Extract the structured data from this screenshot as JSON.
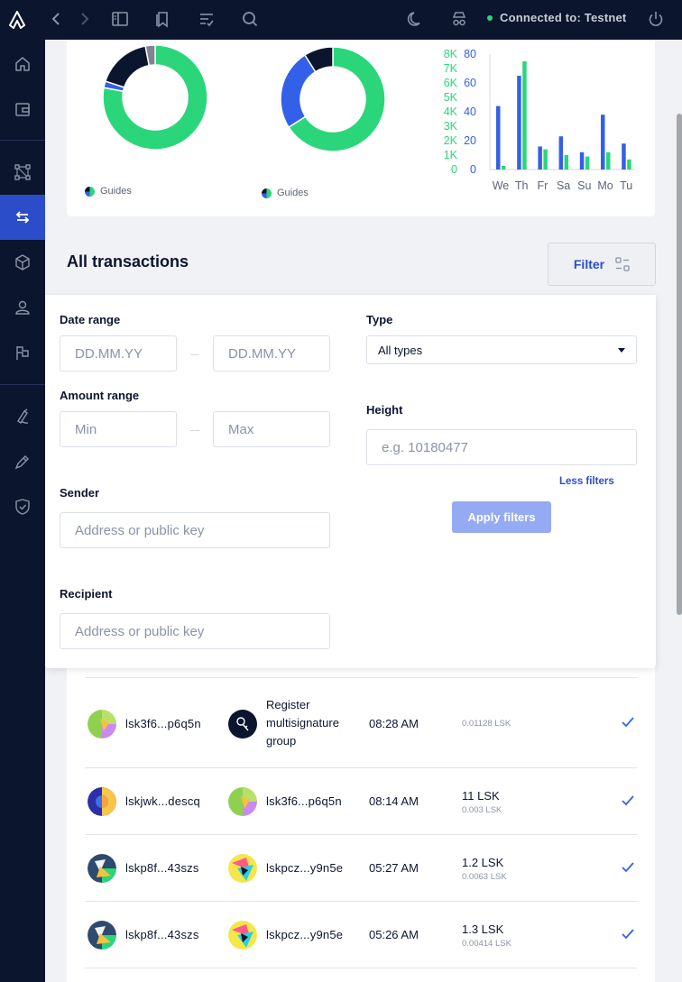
{
  "topbar": {
    "connection_label": "Connected to: Testnet"
  },
  "charts": {
    "left_legend": "Guides",
    "right_legend": "Guides"
  },
  "chart_data": [
    {
      "type": "pie",
      "variant": "donut",
      "slices": [
        {
          "value": 78,
          "color": "#2bd67b"
        },
        {
          "value": 2,
          "color": "#3360e8"
        },
        {
          "value": 17,
          "color": "#0c152e"
        },
        {
          "value": 3,
          "color": "#7e8494"
        }
      ],
      "legend": [
        "Guides"
      ]
    },
    {
      "type": "pie",
      "variant": "donut",
      "slices": [
        {
          "value": 66,
          "color": "#2bd67b"
        },
        {
          "value": 25,
          "color": "#3360e8"
        },
        {
          "value": 9,
          "color": "#0c152e"
        }
      ],
      "legend": [
        "Guides"
      ]
    },
    {
      "type": "bar",
      "categories": [
        "We",
        "Th",
        "Fr",
        "Sa",
        "Su",
        "Mo",
        "Tu"
      ],
      "series": [
        {
          "axis": "left_count",
          "color": "#3360e8",
          "values": [
            44,
            65,
            16,
            23,
            12,
            38,
            18
          ]
        },
        {
          "axis": "right_volume",
          "color": "#2bd67b",
          "values": [
            250,
            7500,
            1400,
            1000,
            900,
            1200,
            700
          ]
        }
      ],
      "y_left": {
        "ticks": [
          0,
          20,
          40,
          60,
          80
        ],
        "color": "#3360e8",
        "ylim": [
          0,
          80
        ]
      },
      "y_right": {
        "ticks": [
          "0",
          "1K",
          "2K",
          "3K",
          "4K",
          "5K",
          "6K",
          "7K",
          "8K"
        ],
        "color": "#2bd67b",
        "ylim": [
          0,
          8000
        ]
      }
    }
  ],
  "heading": {
    "title": "All transactions",
    "filter_label": "Filter"
  },
  "filters": {
    "date_range_label": "Date range",
    "date_from_placeholder": "DD.MM.YY",
    "date_to_placeholder": "DD.MM.YY",
    "type_label": "Type",
    "type_value": "All types",
    "amount_range_label": "Amount range",
    "amount_min_placeholder": "Min",
    "amount_max_placeholder": "Max",
    "height_label": "Height",
    "height_placeholder": "e.g. 10180477",
    "less_filters": "Less filters",
    "sender_label": "Sender",
    "sender_placeholder": "Address or public key",
    "apply_label": "Apply filters",
    "recipient_label": "Recipient",
    "recipient_placeholder": "Address or public key"
  },
  "transactions": [
    {
      "sender": "lsk3f6...p6q5n",
      "recipient_type": "Register multisignature group",
      "time": "08:28 AM",
      "amount": "",
      "fee": "0.01128 LSK"
    },
    {
      "sender": "lskjwk...descq",
      "recipient": "lsk3f6...p6q5n",
      "time": "08:14 AM",
      "amount": "11 LSK",
      "fee": "0.003 LSK"
    },
    {
      "sender": "lskp8f...43szs",
      "recipient": "lskpcz...y9n5e",
      "time": "05:27 AM",
      "amount": "1.2 LSK",
      "fee": "0.0063 LSK"
    },
    {
      "sender": "lskp8f...43szs",
      "recipient": "lskpcz...y9n5e",
      "time": "05:26 AM",
      "amount": "1.3 LSK",
      "fee": "0.00414 LSK"
    }
  ],
  "colors": {
    "navy": "#0c152e",
    "accent_blue": "#2c4dc9",
    "green": "#2bd67b",
    "chart_blue": "#3360e8"
  }
}
